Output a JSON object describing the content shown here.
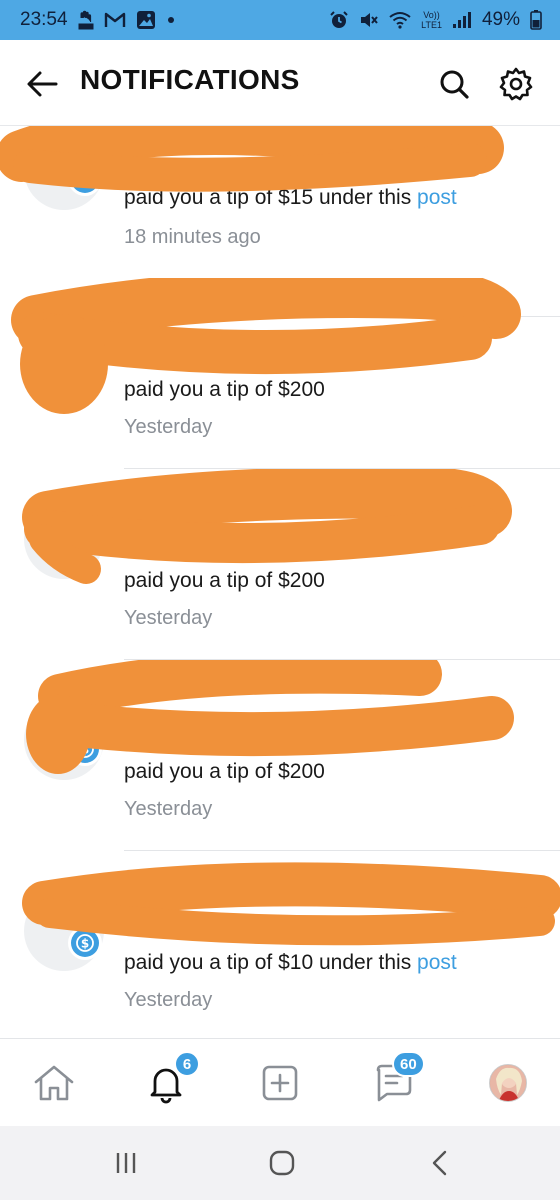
{
  "status_bar": {
    "time": "23:54",
    "battery_percent": "49%",
    "network_label": "LTE1",
    "left_icons": [
      "notification-hand-icon",
      "gmail-icon",
      "gallery-icon",
      "dot-icon"
    ],
    "right_icons": [
      "alarm-icon",
      "mute-icon",
      "wifi-icon",
      "volte-icon",
      "signal-icon",
      "battery-icon"
    ],
    "bar_color": "#4ea8e4"
  },
  "header": {
    "title": "NOTIFICATIONS"
  },
  "notifications": [
    {
      "message": "paid you a tip of $15 under this ",
      "link_text": "post",
      "time": "18 minutes ago",
      "name_redacted": true
    },
    {
      "message": "paid you a tip of $200",
      "link_text": "",
      "time": "Yesterday",
      "name_redacted": true
    },
    {
      "message": "paid you a tip of $200",
      "link_text": "",
      "time": "Yesterday",
      "name_redacted": true
    },
    {
      "message": "paid you a tip of $200",
      "link_text": "",
      "time": "Yesterday",
      "name_redacted": true
    },
    {
      "message": "paid you a tip of $10 under this ",
      "link_text": "post",
      "time": "Yesterday",
      "name_redacted": true
    }
  ],
  "bottom_nav": {
    "items": [
      "home-icon",
      "bell-icon",
      "add-post-icon",
      "messages-icon",
      "profile-avatar"
    ],
    "notifications_badge": "6",
    "messages_badge": "60"
  },
  "system_nav": {
    "items": [
      "recents-icon",
      "home-button-icon",
      "back-icon"
    ]
  },
  "colors": {
    "accent": "#3d9ee0",
    "redaction": "#f0913a",
    "muted_text": "#8a8f96"
  }
}
